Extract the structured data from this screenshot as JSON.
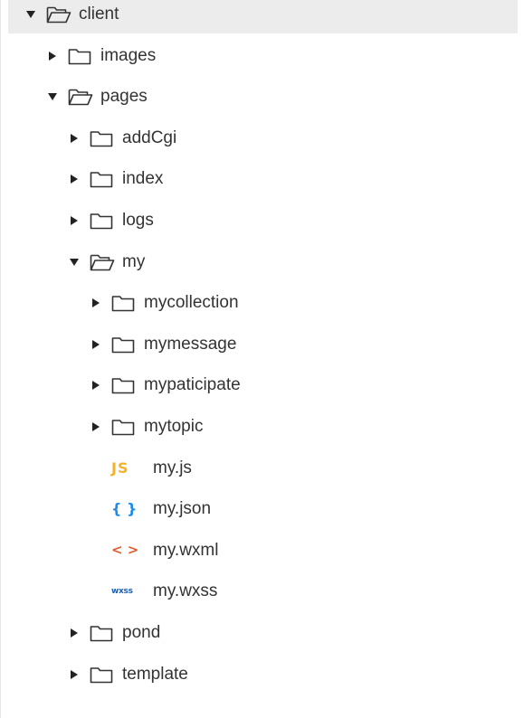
{
  "explorer": {
    "items": [
      {
        "label": "client",
        "type": "folder",
        "expanded": true,
        "depth": 0,
        "selected": true
      },
      {
        "label": "images",
        "type": "folder",
        "expanded": false,
        "depth": 1
      },
      {
        "label": "pages",
        "type": "folder",
        "expanded": true,
        "depth": 1
      },
      {
        "label": "addCgi",
        "type": "folder",
        "expanded": false,
        "depth": 2
      },
      {
        "label": "index",
        "type": "folder",
        "expanded": false,
        "depth": 2
      },
      {
        "label": "logs",
        "type": "folder",
        "expanded": false,
        "depth": 2
      },
      {
        "label": "my",
        "type": "folder",
        "expanded": true,
        "depth": 2
      },
      {
        "label": "mycollection",
        "type": "folder",
        "expanded": false,
        "depth": 3
      },
      {
        "label": "mymessage",
        "type": "folder",
        "expanded": false,
        "depth": 3
      },
      {
        "label": "mypaticipate",
        "type": "folder",
        "expanded": false,
        "depth": 3
      },
      {
        "label": "mytopic",
        "type": "folder",
        "expanded": false,
        "depth": 3
      },
      {
        "label": "my.js",
        "type": "file",
        "filetype": "js",
        "badge": "JS",
        "depth": 3
      },
      {
        "label": "my.json",
        "type": "file",
        "filetype": "json",
        "badge": "{ }",
        "depth": 3
      },
      {
        "label": "my.wxml",
        "type": "file",
        "filetype": "wxml",
        "badge": "< >",
        "depth": 3
      },
      {
        "label": "my.wxss",
        "type": "file",
        "filetype": "wxss",
        "badge": "wxss",
        "depth": 3
      },
      {
        "label": "pond",
        "type": "folder",
        "expanded": false,
        "depth": 2
      },
      {
        "label": "template",
        "type": "folder",
        "expanded": false,
        "depth": 2
      }
    ],
    "icons": {
      "expanded_arrow": "caret-down-icon",
      "collapsed_arrow": "caret-right-icon",
      "open_folder": "folder-open-icon",
      "closed_folder": "folder-icon"
    },
    "colors": {
      "text": "#333333",
      "selected_bg": "#ececec",
      "js": "#f2b32a",
      "json": "#1f8ce6",
      "wxml": "#e05a2b",
      "wxss": "#1a5fb4"
    }
  }
}
